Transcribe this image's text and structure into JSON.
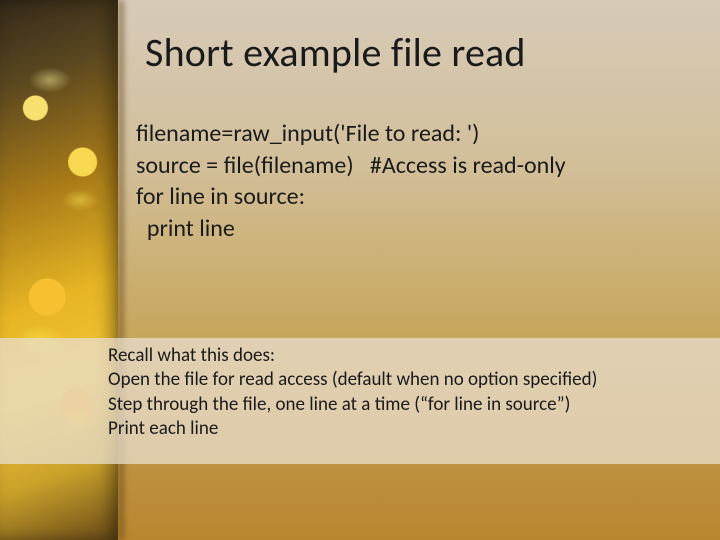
{
  "slide": {
    "title": "Short example file read",
    "code": {
      "line1": "filename=raw_input('File to read: ')",
      "line2": "source = file(filename)   #Access is read-only",
      "line3": "for line in source:",
      "line4": "  print line"
    },
    "explain": {
      "l1": "Recall what this does:",
      "l2": "Open the file for read access (default when no option specified)",
      "l3": "Step through the file, one line at a time (“for line in source”)",
      "l4": "Print each line"
    }
  }
}
